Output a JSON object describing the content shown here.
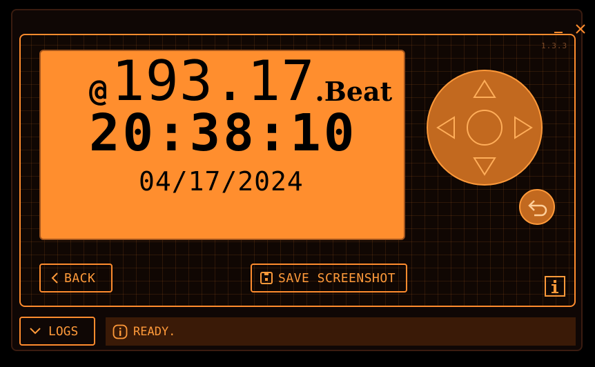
{
  "window": {
    "version": "1.3.3"
  },
  "display": {
    "beat_prefix": "@",
    "beat_value": "193.17",
    "beat_unit": ".Beat",
    "time": "20:38:10",
    "date": "04/17/2024"
  },
  "buttons": {
    "back_label": "BACK",
    "save_label": "SAVE SCREENSHOT",
    "logs_label": "LOGS"
  },
  "status": {
    "text": "READY."
  },
  "icons": {
    "minimize": "minimize-icon",
    "close": "close-icon",
    "dpad_up": "arrow-up-icon",
    "dpad_down": "arrow-down-icon",
    "dpad_left": "arrow-left-icon",
    "dpad_right": "arrow-right-icon",
    "dpad_center": "center-button-icon",
    "return": "return-icon",
    "info": "info-icon",
    "save": "floppy-icon",
    "back": "chevron-left-icon",
    "logs": "chevron-down-icon",
    "status": "info-circle-icon"
  },
  "colors": {
    "accent": "#ff8c2e",
    "lcd_background": "#ff8e2e",
    "lcd_text": "#000000",
    "status_bar": "#3a1a07",
    "background": "#0f0705"
  }
}
